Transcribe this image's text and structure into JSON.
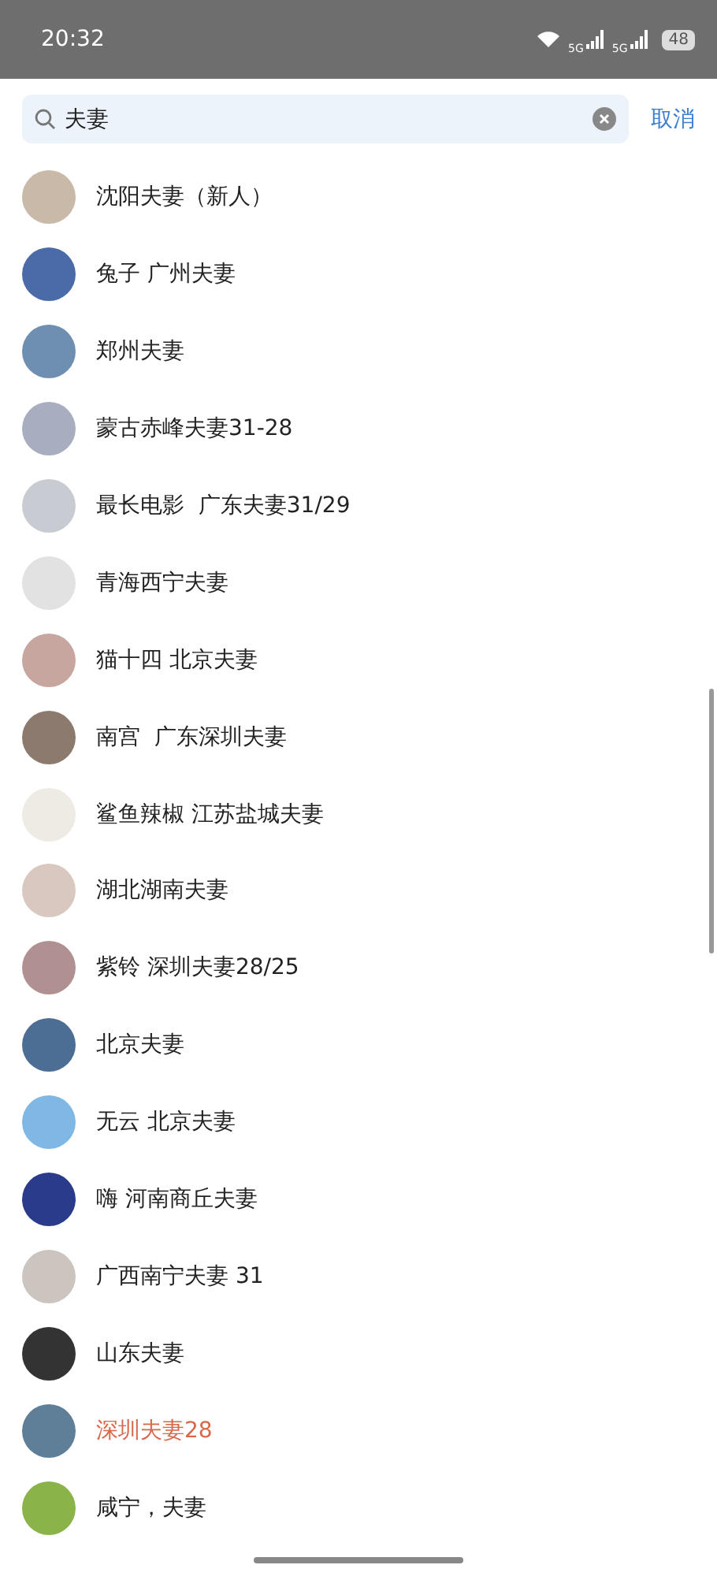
{
  "status_bar": {
    "time": "20:32",
    "battery": "48",
    "network_1": "5G",
    "network_2": "5G"
  },
  "search": {
    "value": "夫妻",
    "cancel": "取消"
  },
  "results": [
    {
      "name": "沈阳夫妻（新人）",
      "highlighted": false
    },
    {
      "name": "兔子 广州夫妻",
      "highlighted": false
    },
    {
      "name": "郑州夫妻",
      "highlighted": false
    },
    {
      "name": "蒙古赤峰夫妻31-28",
      "highlighted": false
    },
    {
      "name": "最长电影  广东夫妻31/29",
      "highlighted": false
    },
    {
      "name": "青海西宁夫妻",
      "highlighted": false
    },
    {
      "name": "猫十四 北京夫妻",
      "highlighted": false
    },
    {
      "name": "南宫  广东深圳夫妻",
      "highlighted": false
    },
    {
      "name": "鲨鱼辣椒 江苏盐城夫妻",
      "highlighted": false
    },
    {
      "name": "湖北湖南夫妻",
      "highlighted": false
    },
    {
      "name": "紫铃 深圳夫妻28/25",
      "highlighted": false
    },
    {
      "name": "北京夫妻",
      "highlighted": false
    },
    {
      "name": "无云 北京夫妻",
      "highlighted": false
    },
    {
      "name": "嗨 河南商丘夫妻",
      "highlighted": false
    },
    {
      "name": "广西南宁夫妻 31",
      "highlighted": false
    },
    {
      "name": "山东夫妻",
      "highlighted": false
    },
    {
      "name": "深圳夫妻28",
      "highlighted": true
    },
    {
      "name": "咸宁，夫妻",
      "highlighted": false
    }
  ]
}
